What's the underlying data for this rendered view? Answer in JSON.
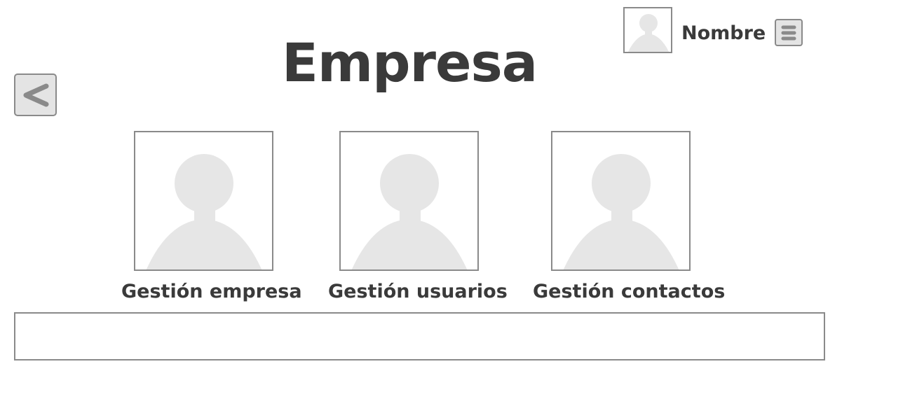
{
  "header": {
    "title": "Empresa",
    "user_name": "Nombre",
    "avatar_icon": "user-placeholder-icon",
    "menu_icon": "hamburger-menu-icon",
    "back_icon": "chevron-left-icon"
  },
  "cards": [
    {
      "label": "Gestión empresa",
      "icon": "user-placeholder-icon"
    },
    {
      "label": "Gestión usuarios",
      "icon": "user-placeholder-icon"
    },
    {
      "label": "Gestión contactos",
      "icon": "user-placeholder-icon"
    }
  ],
  "input": {
    "value": ""
  },
  "colors": {
    "text": "#3a3a3a",
    "border": "#8a8a8a",
    "placeholder_fill": "#e6e6e6",
    "button_fill": "#e4e4e4"
  }
}
